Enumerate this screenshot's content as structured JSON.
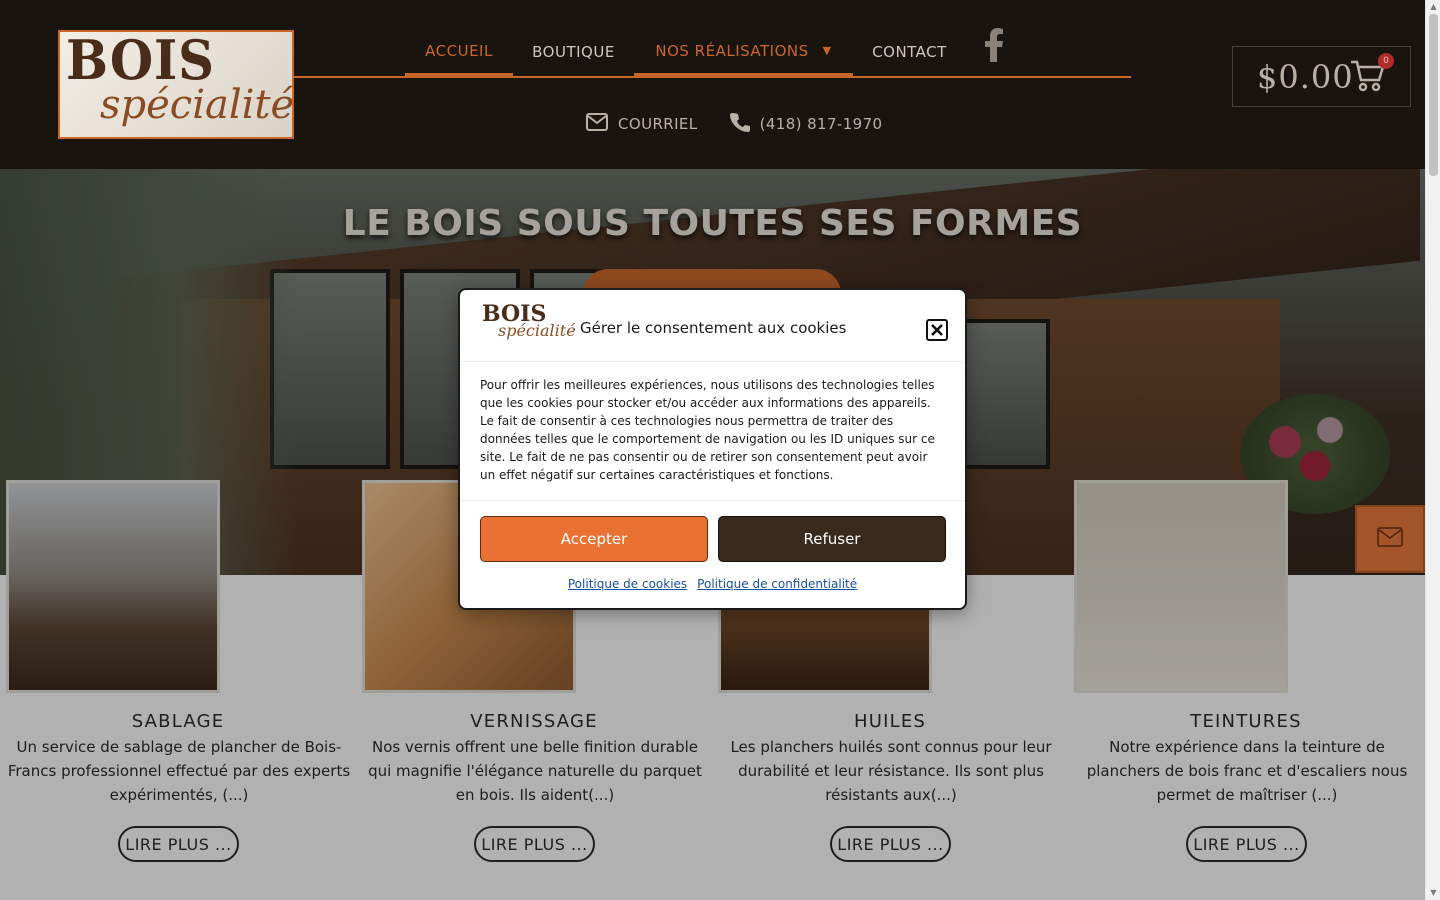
{
  "brand": {
    "logo_line1": "BOIS",
    "logo_line2": "spécialité"
  },
  "nav": {
    "items": [
      {
        "label": "ACCUEIL"
      },
      {
        "label": "BOUTIQUE"
      },
      {
        "label": "NOS RÉALISATIONS"
      },
      {
        "label": "CONTACT"
      }
    ],
    "social_icon": "facebook-icon"
  },
  "contact": {
    "email_label": "COURRIEL",
    "phone": "(418) 817-1970"
  },
  "cart": {
    "amount": "$0.00",
    "count": "0"
  },
  "hero": {
    "title": "LE BOIS SOUS TOUTES SES FORMES"
  },
  "services": [
    {
      "title": "SABLAGE",
      "text": "Un service de sablage de plancher de Bois-Francs professionnel effectué par des experts expérimentés, (...)",
      "button": "LIRE PLUS ..."
    },
    {
      "title": "VERNISSAGE",
      "text": "Nos vernis offrent une belle finition durable qui magnifie l'élégance naturelle du parquet en bois. Ils aident(...)",
      "button": "LIRE PLUS ..."
    },
    {
      "title": "HUILES",
      "text": "Les planchers huilés sont connus pour leur durabilité et leur résistance. Ils sont plus résistants aux(...)",
      "button": "LIRE PLUS ..."
    },
    {
      "title": "TEINTURES",
      "text": "Notre expérience dans la teinture de planchers de bois franc et d'escaliers nous permet de maîtriser (...)",
      "button": "LIRE PLUS ..."
    }
  ],
  "cookie_modal": {
    "logo_line1": "BOIS",
    "logo_line2": "spécialité",
    "title": "Gérer le consentement aux cookies",
    "body": "Pour offrir les meilleures expériences, nous utilisons des technologies telles que les cookies pour stocker et/ou accéder aux informations des appareils. Le fait de consentir à ces technologies nous permettra de traiter des données telles que le comportement de navigation ou les ID uniques sur ce site. Le fait de ne pas consentir ou de retirer son consentement peut avoir un effet négatif sur certaines caractéristiques et fonctions.",
    "accept": "Accepter",
    "refuse": "Refuser",
    "link_cookies": "Politique de cookies",
    "link_privacy": "Politique de confidentialité"
  },
  "colors": {
    "accent": "#c8662c",
    "header_bg": "#1a140f",
    "accept_btn": "#e97131",
    "refuse_btn": "#3a2a1d"
  }
}
